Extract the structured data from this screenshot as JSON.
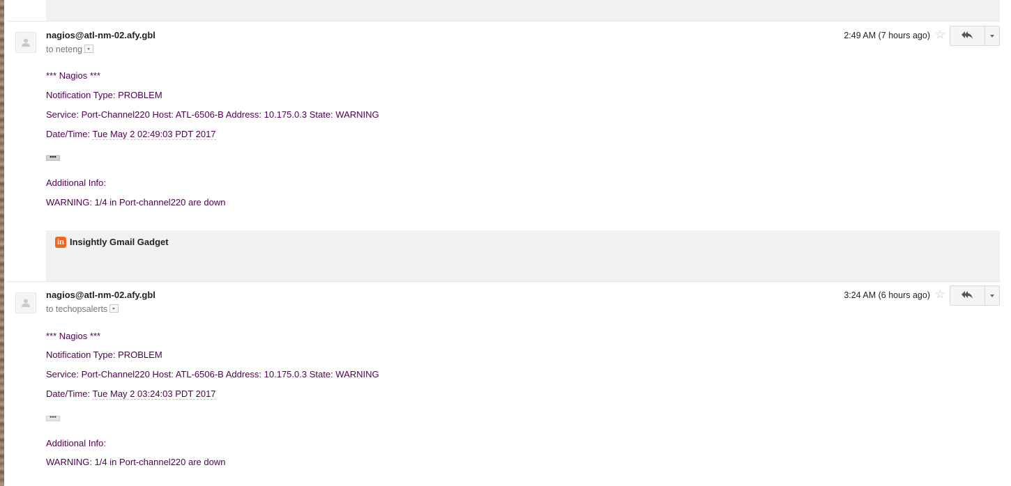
{
  "messages": [
    {
      "sender": "nagios@atl-nm-02.afy.gbl",
      "to": "to neteng",
      "time": "2:49 AM (7 hours ago)",
      "lines": {
        "header": "*** Nagios ***",
        "notification": "Notification Type: PROBLEM",
        "service": "Service: Port-Channel220 Host: ATL-6506-B Address: 10.175.0.3 State: WARNING",
        "date_label": "Date/Time: ",
        "date_value": "Tue May 2 02:49:03 PDT 2017",
        "additional": "Additional Info:",
        "warning": "WARNING: 1/4 in Port-channel220 are down"
      },
      "ellipsis": "•••"
    },
    {
      "sender": "nagios@atl-nm-02.afy.gbl",
      "to": "to techopsalerts",
      "time": "3:24 AM (6 hours ago)",
      "lines": {
        "header": "*** Nagios ***",
        "notification": "Notification Type: PROBLEM",
        "service": "Service: Port-Channel220 Host: ATL-6506-B Address: 10.175.0.3 State: WARNING",
        "date_label": "Date/Time: ",
        "date_value": "Tue May 2 03:24:03 PDT 2017",
        "additional": "Additional Info:",
        "warning": "WARNING: 1/4 in Port-channel220 are down"
      },
      "ellipsis": "•••"
    }
  ],
  "gadget": {
    "logo": "in",
    "title": "Insightly Gmail Gadget"
  },
  "icons": {
    "avatar": "person-icon",
    "star": "star-icon",
    "reply": "reply-all-icon",
    "more": "chevron-down-icon"
  },
  "colors": {
    "body_text": "#500050",
    "gadget_brand": "#f26522"
  }
}
